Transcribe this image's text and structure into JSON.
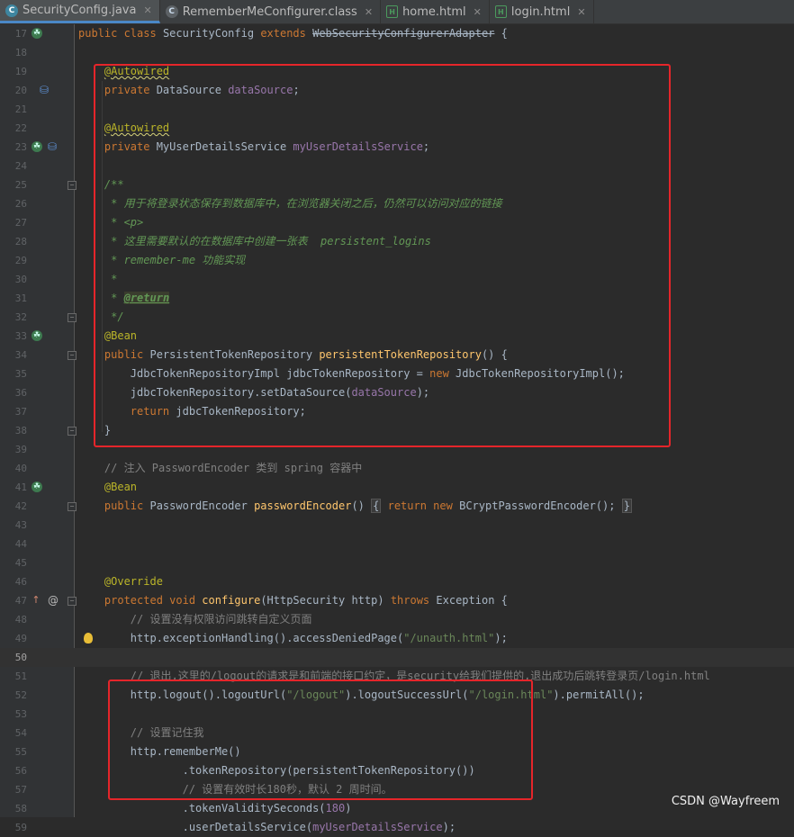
{
  "tabs": [
    {
      "label": "SecurityConfig.java",
      "icon": "java-class-icon",
      "active": true
    },
    {
      "label": "RememberMeConfigurer.class",
      "icon": "class-file-icon",
      "active": false
    },
    {
      "label": "home.html",
      "icon": "html-file-icon",
      "active": false
    },
    {
      "label": "login.html",
      "icon": "html-file-icon",
      "active": false
    }
  ],
  "current_line": 50,
  "code_lines": [
    {
      "n": "17",
      "tokens": [
        [
          "kw",
          "public "
        ],
        [
          "kw",
          "class "
        ],
        [
          "p",
          "SecurityConfig "
        ],
        [
          "kw",
          "extends "
        ],
        [
          "strike",
          "WebSecurityConfigurerAdapter"
        ],
        [
          "p",
          " {"
        ]
      ],
      "gutter": [
        "bean-icon"
      ]
    },
    {
      "n": "18",
      "tokens": []
    },
    {
      "n": "19",
      "tokens": [
        [
          "p",
          "    "
        ],
        [
          "annsq",
          "@Autowired"
        ]
      ]
    },
    {
      "n": "20",
      "tokens": [
        [
          "p",
          "    "
        ],
        [
          "kw",
          "private "
        ],
        [
          "p",
          "DataSource "
        ],
        [
          "field",
          "dataSource"
        ],
        [
          "p",
          ";"
        ]
      ],
      "gutter": [
        "inject-icon"
      ]
    },
    {
      "n": "21",
      "tokens": []
    },
    {
      "n": "22",
      "tokens": [
        [
          "p",
          "    "
        ],
        [
          "annsq",
          "@Autowired"
        ]
      ]
    },
    {
      "n": "23",
      "tokens": [
        [
          "p",
          "    "
        ],
        [
          "kw",
          "private "
        ],
        [
          "p",
          "MyUserDetailsService "
        ],
        [
          "field",
          "myUserDetailsService"
        ],
        [
          "p",
          ";"
        ]
      ],
      "gutter": [
        "bean-icon",
        "inject-icon"
      ]
    },
    {
      "n": "24",
      "tokens": []
    },
    {
      "n": "25",
      "tokens": [
        [
          "p",
          "    "
        ],
        [
          "doc",
          "/**"
        ]
      ],
      "fold": true
    },
    {
      "n": "26",
      "tokens": [
        [
          "p",
          "    "
        ],
        [
          "doc",
          " * 用于将登录状态保存到数据库中，在浏览器关闭之后，仍然可以访问对应的链接"
        ]
      ]
    },
    {
      "n": "27",
      "tokens": [
        [
          "p",
          "    "
        ],
        [
          "doc",
          " * <p>"
        ]
      ]
    },
    {
      "n": "28",
      "tokens": [
        [
          "p",
          "    "
        ],
        [
          "doc",
          " * 这里需要默认的在数据库中创建一张表  persistent_logins"
        ]
      ]
    },
    {
      "n": "29",
      "tokens": [
        [
          "p",
          "    "
        ],
        [
          "doc",
          " * remember-me 功能实现"
        ]
      ]
    },
    {
      "n": "30",
      "tokens": [
        [
          "p",
          "    "
        ],
        [
          "doc",
          " *"
        ]
      ]
    },
    {
      "n": "31",
      "tokens": [
        [
          "p",
          "    "
        ],
        [
          "doc",
          " * "
        ],
        [
          "doctag",
          "@return"
        ]
      ]
    },
    {
      "n": "32",
      "tokens": [
        [
          "p",
          "    "
        ],
        [
          "doc",
          " */"
        ]
      ],
      "fold": true
    },
    {
      "n": "33",
      "tokens": [
        [
          "p",
          "    "
        ],
        [
          "ann",
          "@Bean"
        ]
      ],
      "gutter": [
        "bean-icon"
      ]
    },
    {
      "n": "34",
      "tokens": [
        [
          "p",
          "    "
        ],
        [
          "kw",
          "public "
        ],
        [
          "p",
          "PersistentTokenRepository "
        ],
        [
          "method",
          "persistentTokenRepository"
        ],
        [
          "p",
          "() {"
        ]
      ],
      "fold": true
    },
    {
      "n": "35",
      "tokens": [
        [
          "p",
          "        JdbcTokenRepositoryImpl jdbcTokenRepository = "
        ],
        [
          "kw",
          "new "
        ],
        [
          "p",
          "JdbcTokenRepositoryImpl();"
        ]
      ]
    },
    {
      "n": "36",
      "tokens": [
        [
          "p",
          "        jdbcTokenRepository.setDataSource("
        ],
        [
          "field",
          "dataSource"
        ],
        [
          "p",
          ");"
        ]
      ]
    },
    {
      "n": "37",
      "tokens": [
        [
          "p",
          "        "
        ],
        [
          "kw",
          "return "
        ],
        [
          "p",
          "jdbcTokenRepository;"
        ]
      ]
    },
    {
      "n": "38",
      "tokens": [
        [
          "p",
          "    }"
        ]
      ],
      "fold": true
    },
    {
      "n": "39",
      "tokens": []
    },
    {
      "n": "40",
      "tokens": [
        [
          "p",
          "    "
        ],
        [
          "cmt",
          "// 注入 PasswordEncoder 类到 spring 容器中"
        ]
      ]
    },
    {
      "n": "41",
      "tokens": [
        [
          "p",
          "    "
        ],
        [
          "ann",
          "@Bean"
        ]
      ],
      "gutter": [
        "bean-icon"
      ]
    },
    {
      "n": "42",
      "tokens": [
        [
          "p",
          "    "
        ],
        [
          "kw",
          "public "
        ],
        [
          "p",
          "PasswordEncoder "
        ],
        [
          "method",
          "passwordEncoder"
        ],
        [
          "p",
          "() "
        ],
        [
          "brace",
          "{"
        ],
        [
          "p",
          " "
        ],
        [
          "kw",
          "return new "
        ],
        [
          "p",
          "BCryptPasswordEncoder(); "
        ],
        [
          "brace",
          "}"
        ]
      ],
      "fold": true
    },
    {
      "n": "43",
      "tokens": []
    },
    {
      "n": "44",
      "tokens": []
    },
    {
      "n": "45",
      "tokens": []
    },
    {
      "n": "46",
      "tokens": [
        [
          "p",
          "    "
        ],
        [
          "ann",
          "@Override"
        ]
      ]
    },
    {
      "n": "47",
      "tokens": [
        [
          "p",
          "    "
        ],
        [
          "kw",
          "protected void "
        ],
        [
          "method",
          "configure"
        ],
        [
          "p",
          "(HttpSecurity http) "
        ],
        [
          "kw",
          "throws "
        ],
        [
          "p",
          "Exception {"
        ]
      ],
      "gutter": [
        "override-icon",
        "at-icon"
      ],
      "fold": true
    },
    {
      "n": "48",
      "tokens": [
        [
          "p",
          "        "
        ],
        [
          "cmt",
          "// 设置没有权限访问跳转自定义页面"
        ]
      ]
    },
    {
      "n": "49",
      "tokens": [
        [
          "p",
          "        http.exceptionHandling().accessDeniedPage("
        ],
        [
          "str",
          "\"/unauth.html\""
        ],
        [
          "p",
          ");"
        ]
      ],
      "bulb": true
    },
    {
      "n": "50",
      "tokens": []
    },
    {
      "n": "51",
      "tokens": [
        [
          "p",
          "        "
        ],
        [
          "cmt",
          "// 退出,这里的/logout的请求是和前端的接口约定，是security给我们提供的,退出成功后跳转登录页/login.html"
        ]
      ]
    },
    {
      "n": "52",
      "tokens": [
        [
          "p",
          "        http.logout().logoutUrl("
        ],
        [
          "str",
          "\"/logout\""
        ],
        [
          "p",
          ").logoutSuccessUrl("
        ],
        [
          "str",
          "\"/login.html\""
        ],
        [
          "p",
          ").permitAll();"
        ]
      ]
    },
    {
      "n": "53",
      "tokens": []
    },
    {
      "n": "54",
      "tokens": [
        [
          "p",
          "        "
        ],
        [
          "cmt",
          "// 设置记住我"
        ]
      ]
    },
    {
      "n": "55",
      "tokens": [
        [
          "p",
          "        http.rememberMe()"
        ]
      ]
    },
    {
      "n": "56",
      "tokens": [
        [
          "p",
          "                .tokenRepository(persistentTokenRepository())"
        ]
      ]
    },
    {
      "n": "57",
      "tokens": [
        [
          "p",
          "                "
        ],
        [
          "cmt",
          "// 设置有效时长180秒，默认 2 周时间。"
        ]
      ]
    },
    {
      "n": "58",
      "tokens": [
        [
          "p",
          "                .tokenValiditySeconds("
        ],
        [
          "num",
          "180"
        ],
        [
          "p",
          ")"
        ]
      ]
    },
    {
      "n": "59",
      "tokens": [
        [
          "p",
          "                .userDetailsService("
        ],
        [
          "field",
          "myUserDetailsService"
        ],
        [
          "p",
          ");"
        ]
      ]
    }
  ],
  "watermark": "CSDN @Wayfreem",
  "colors": {
    "highlight_box": "#e5252a",
    "background": "#2b2b2b",
    "gutter": "#313335"
  }
}
